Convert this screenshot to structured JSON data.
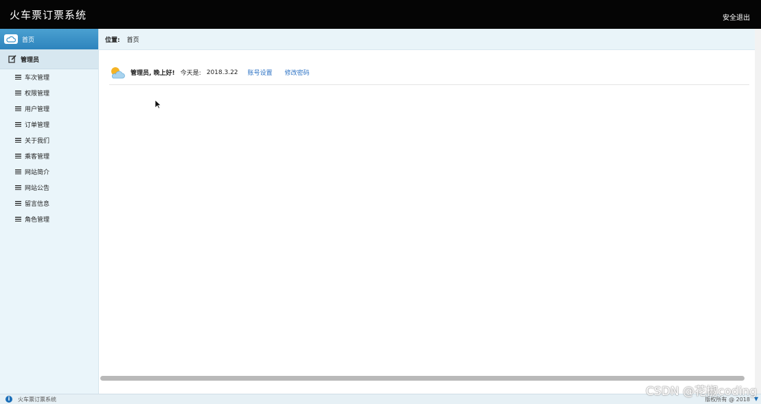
{
  "app": {
    "title": "火车票订票系统",
    "logout_label": "安全退出"
  },
  "sidebar": {
    "home_label": "首页",
    "group_label": "管理员",
    "items": [
      {
        "label": "车次管理"
      },
      {
        "label": "权限管理"
      },
      {
        "label": "用户管理"
      },
      {
        "label": "订单管理"
      },
      {
        "label": "关于我们"
      },
      {
        "label": "乘客管理"
      },
      {
        "label": "网站简介"
      },
      {
        "label": "网站公告"
      },
      {
        "label": "留言信息"
      },
      {
        "label": "角色管理"
      }
    ]
  },
  "breadcrumb": {
    "label": "位置:",
    "current": "首页"
  },
  "welcome": {
    "greeting": "管理员, 晚上好!",
    "today_label": "今天是:",
    "date": "2018.3.22",
    "account_link": "账号设置",
    "password_link": "修改密码"
  },
  "footer": {
    "title": "火车票订票系统",
    "copyright": "版权所有 @ 2018"
  },
  "watermark": "CSDN @花椒coding",
  "colors": {
    "topbar": "#050505",
    "sidebar": "#eaf5fa",
    "home_active": "#3a92c8",
    "link": "#2c72c4"
  }
}
